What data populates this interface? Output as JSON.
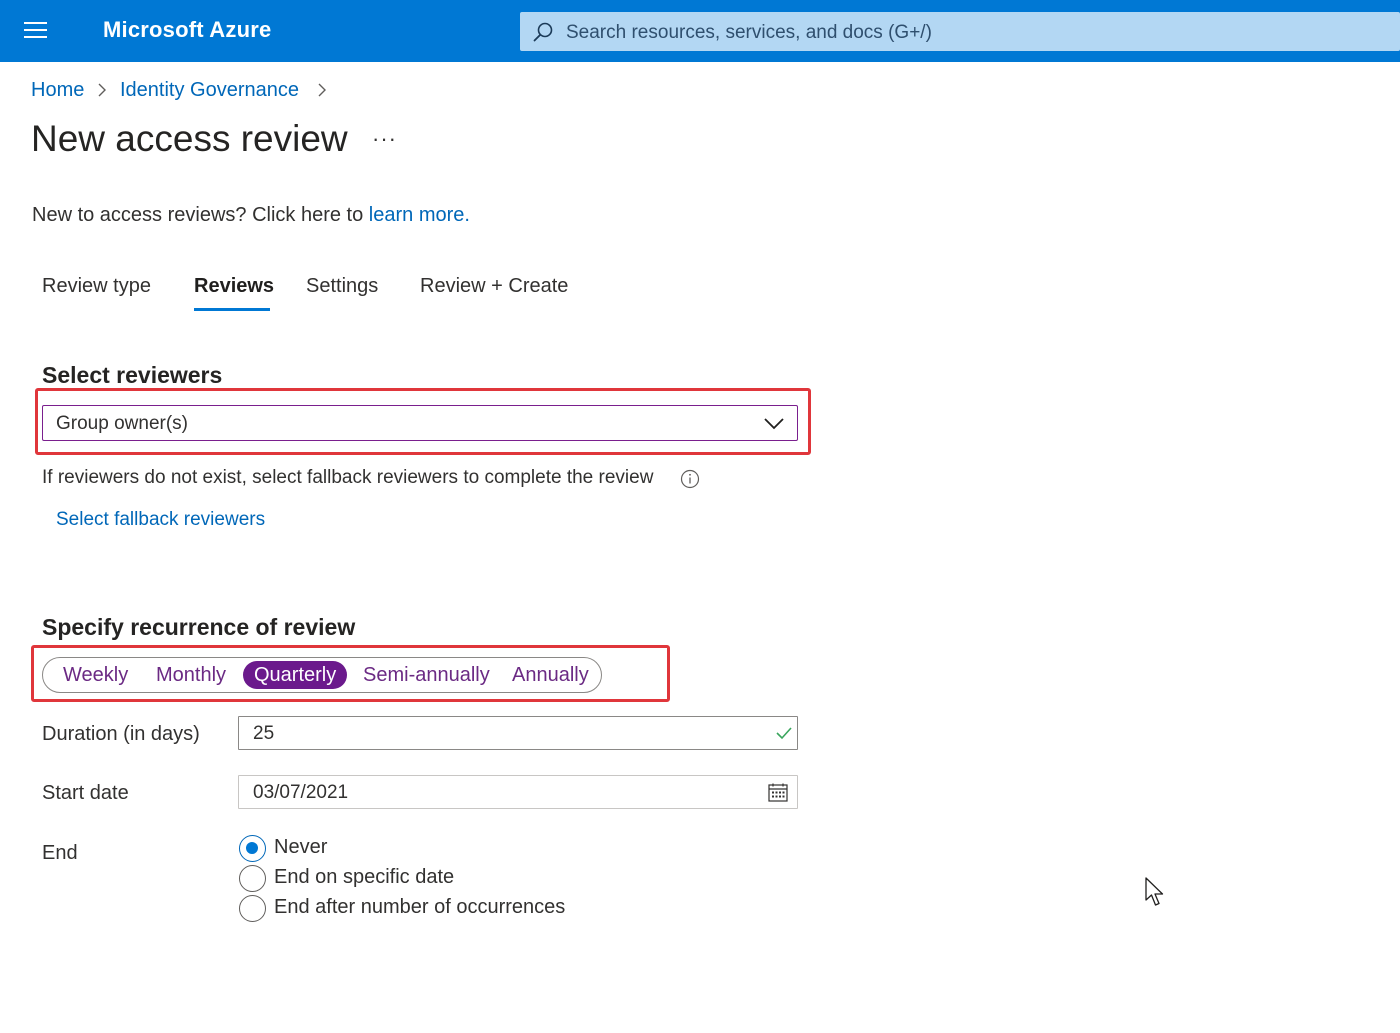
{
  "header": {
    "brand": "Microsoft Azure",
    "search_placeholder": "Search resources, services, and docs (G+/)"
  },
  "breadcrumb": {
    "items": [
      "Home",
      "Identity Governance"
    ]
  },
  "page": {
    "title": "New access review",
    "more": "···",
    "intro_text": "New to access reviews? Click here to ",
    "intro_link": "learn more."
  },
  "tabs": [
    {
      "label": "Review type",
      "active": false
    },
    {
      "label": "Reviews",
      "active": true
    },
    {
      "label": "Settings",
      "active": false
    },
    {
      "label": "Review + Create",
      "active": false
    }
  ],
  "reviewers": {
    "title": "Select reviewers",
    "selected": "Group owner(s)",
    "helper": "If reviewers do not exist, select fallback reviewers to complete the review",
    "fallback_link": "Select fallback reviewers"
  },
  "recurrence": {
    "title": "Specify recurrence of review",
    "options": [
      "Weekly",
      "Monthly",
      "Quarterly",
      "Semi-annually",
      "Annually"
    ],
    "selected": "Quarterly"
  },
  "duration": {
    "label": "Duration (in days)",
    "value": "25"
  },
  "start_date": {
    "label": "Start date",
    "value": "03/07/2021"
  },
  "end": {
    "label": "End",
    "options": [
      "Never",
      "End on specific date",
      "End after number of occurrences"
    ],
    "selected": "Never"
  },
  "colors": {
    "azure_blue": "#0078d4",
    "link_blue": "#0067b8",
    "highlight_red": "#e0363b",
    "pill_purple": "#6b1a8c"
  }
}
